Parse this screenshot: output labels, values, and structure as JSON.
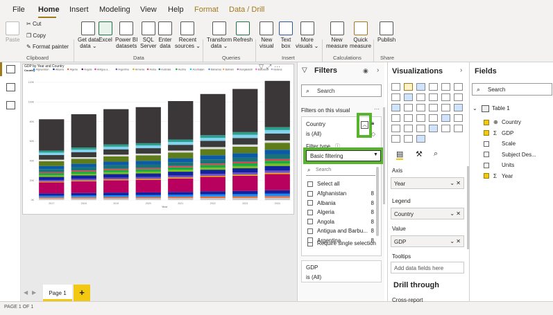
{
  "menu": {
    "file": "File",
    "home": "Home",
    "insert": "Insert",
    "modeling": "Modeling",
    "view": "View",
    "help": "Help",
    "format": "Format",
    "data_drill": "Data / Drill"
  },
  "ribbon": {
    "paste": "Paste",
    "cut": "Cut",
    "copy": "Copy",
    "format_painter": "Format painter",
    "clipboard": "Clipboard",
    "get_data": "Get data",
    "get_data2": "data ⌄",
    "excel": "Excel",
    "pbi": "Power BI",
    "pbi2": "datasets",
    "sql": "SQL",
    "sql2": "Server",
    "enter": "Enter",
    "enter2": "data",
    "recent": "Recent",
    "recent2": "sources ⌄",
    "data_group": "Data",
    "transform": "Transform",
    "transform2": "data ⌄",
    "refresh": "Refresh",
    "queries": "Queries",
    "new_visual": "New",
    "new_visual2": "visual",
    "text_box": "Text",
    "text_box2": "box",
    "more_visuals": "More",
    "more_visuals2": "visuals ⌄",
    "insert_group": "Insert",
    "new_measure": "New",
    "new_measure2": "measure",
    "quick_measure": "Quick",
    "quick_measure2": "measure",
    "calc_group": "Calculations",
    "publish": "Publish",
    "share": "Share"
  },
  "chart_data": {
    "type": "bar",
    "title": "GDP by Year and Country",
    "legend_title": "Country",
    "legend": [
      "Afghanistan",
      "Albania",
      "Algeria",
      "Angola",
      "Antigua a...",
      "Argentina",
      "Armenia",
      "Aruba",
      "Australia",
      "Austria",
      "Azerbaijan",
      "Bahamas",
      "Bahrain",
      "Bangladesh",
      "Barbados",
      "Belarus"
    ],
    "legend_colors": [
      "#118dff",
      "#12239e",
      "#e66c37",
      "#6b007b",
      "#e044a7",
      "#744ec2",
      "#d9b300",
      "#d64550",
      "#197278",
      "#1aab40",
      "#15c6f4",
      "#4092ff",
      "#ffa058",
      "#be5dc9",
      "#f472d0",
      "#b5a1ff"
    ],
    "categories": [
      "2017",
      "2018",
      "2019",
      "2020",
      "2021",
      "2022",
      "2023",
      "2024"
    ],
    "values": [
      80,
      85,
      90,
      92,
      98,
      105,
      110,
      118
    ],
    "ylim": [
      0,
      120
    ],
    "yticks": [
      "0K",
      "20K",
      "40K",
      "60K",
      "80K",
      "100K",
      "120K"
    ],
    "xlabel": "Year",
    "segments": [
      {
        "color": "#c8c8c8",
        "share": 0.02
      },
      {
        "color": "#e66c37",
        "share": 0.015
      },
      {
        "color": "#118dff",
        "share": 0.02
      },
      {
        "color": "#12239e",
        "share": 0.03
      },
      {
        "color": "#b8005e",
        "share": 0.14
      },
      {
        "color": "#f0b000",
        "share": 0.01
      },
      {
        "color": "#744ec2",
        "share": 0.02
      },
      {
        "color": "#12239e",
        "share": 0.04
      },
      {
        "color": "#7cbe1a",
        "share": 0.02
      },
      {
        "color": "#1aab40",
        "share": 0.025
      },
      {
        "color": "#d64550",
        "share": 0.015
      },
      {
        "color": "#197278",
        "share": 0.04
      },
      {
        "color": "#0b5aa8",
        "share": 0.04
      },
      {
        "color": "#5e7c1a",
        "share": 0.06
      },
      {
        "color": "#dcdcdc",
        "share": 0.02
      },
      {
        "color": "#3a3a3a",
        "share": 0.06
      },
      {
        "color": "#82d2f0",
        "share": 0.03
      },
      {
        "color": "#2aa08a",
        "share": 0.025
      },
      {
        "color": "#3b3638",
        "share": 0.4
      }
    ]
  },
  "filters": {
    "title": "Filters",
    "search": "Search",
    "on_visual": "Filters on this visual",
    "country": "Country",
    "country_state": "is (All)",
    "filter_type": "Filter type",
    "basic": "Basic filtering",
    "list_search": "Search",
    "select_all": "Select all",
    "single": "Require single selection",
    "gdp": "GDP",
    "gdp_state": "is (All)",
    "items": [
      {
        "name": "Afghanistan",
        "count": "8"
      },
      {
        "name": "Albania",
        "count": "8"
      },
      {
        "name": "Algeria",
        "count": "8"
      },
      {
        "name": "Angola",
        "count": "8"
      },
      {
        "name": "Antigua and Barbu...",
        "count": "8"
      },
      {
        "name": "Argentina",
        "count": "8"
      }
    ]
  },
  "viz": {
    "title": "Visualizations",
    "axis": "Axis",
    "axis_val": "Year",
    "legend": "Legend",
    "legend_val": "Country",
    "value": "Value",
    "value_val": "GDP",
    "tooltips": "Tooltips",
    "tooltips_ph": "Add data fields here",
    "drill": "Drill through",
    "cross": "Cross-report"
  },
  "fields": {
    "title": "Fields",
    "search": "Search",
    "table": "Table 1",
    "items": [
      {
        "name": "Country",
        "checked": true,
        "icon": "globe"
      },
      {
        "name": "GDP",
        "checked": true,
        "icon": "sigma"
      },
      {
        "name": "Scale",
        "checked": false,
        "icon": ""
      },
      {
        "name": "Subject Des...",
        "checked": false,
        "icon": ""
      },
      {
        "name": "Units",
        "checked": false,
        "icon": ""
      },
      {
        "name": "Year",
        "checked": true,
        "icon": "sigma"
      }
    ]
  },
  "page": {
    "tab": "Page 1",
    "add": "+",
    "status": "PAGE 1 OF 1"
  }
}
